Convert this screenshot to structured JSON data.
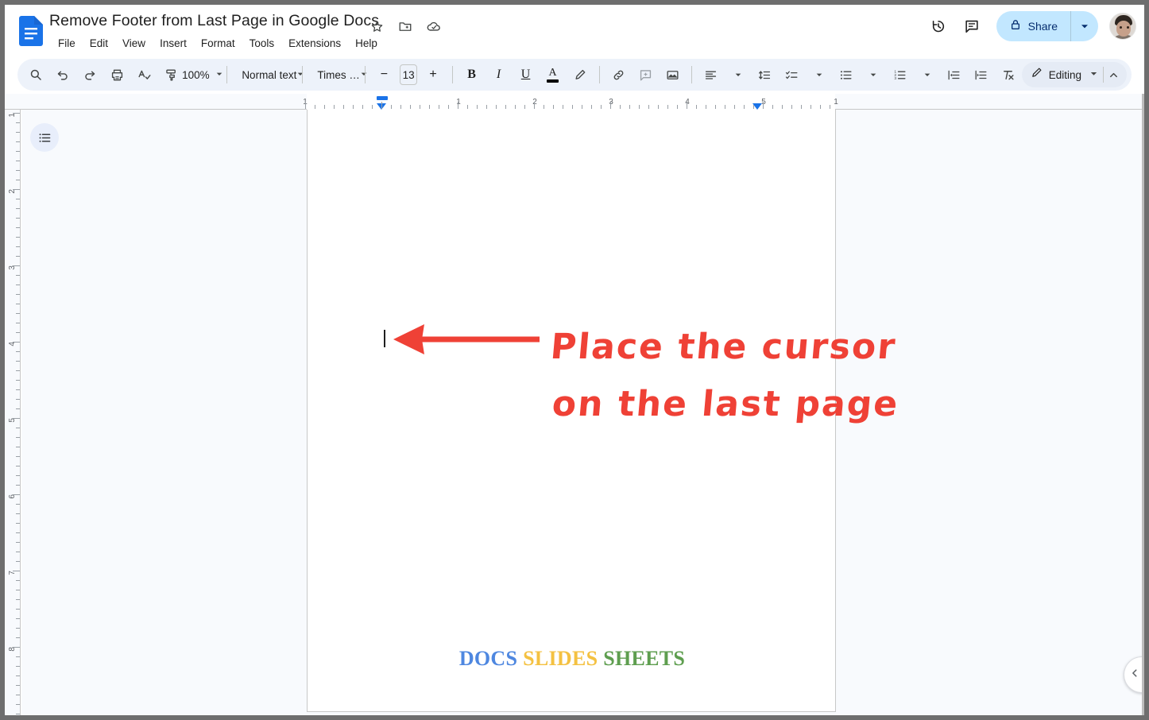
{
  "app": {
    "name": "Google Docs",
    "doc_icon": "google-docs-file-icon"
  },
  "header": {
    "title": "Remove Footer from Last Page in Google Docs",
    "menu": [
      "File",
      "Edit",
      "View",
      "Insert",
      "Format",
      "Tools",
      "Extensions",
      "Help"
    ],
    "title_icons": [
      "star-icon",
      "move-to-folder-icon",
      "cloud-saved-icon"
    ],
    "right": {
      "version_history_label": "version-history-icon",
      "comments_label": "comments-icon",
      "share_label": "Share",
      "share_lock_icon": "lock-icon",
      "share_caret_icon": "chevron-down-icon",
      "avatar_label": "account-avatar",
      "share_bg": "#c2e7ff",
      "share_text_color": "#062e6f"
    }
  },
  "toolbar": {
    "search_icon": "search-icon",
    "undo_icon": "undo-icon",
    "redo_icon": "redo-icon",
    "print_icon": "print-icon",
    "spellcheck_icon": "spelling-grammar-check-icon",
    "paint_format_icon": "paint-format-icon",
    "zoom_value": "100%",
    "style_value": "Normal text",
    "font_value": "Times …",
    "font_size_decrease": "−",
    "font_size_value": "13",
    "font_size_increase": "+",
    "bold_label": "B",
    "italic_label": "I",
    "underline_label": "U",
    "text_color_label": "A",
    "highlight_icon": "highlight-pen-icon",
    "link_icon": "insert-link-icon",
    "comment_icon": "add-comment-icon",
    "image_icon": "insert-image-icon",
    "align_icon": "align-left-icon",
    "line_spacing_icon": "line-spacing-icon",
    "checklist_icon": "checklist-icon",
    "bulleted_list_icon": "bulleted-list-icon",
    "numbered_list_icon": "numbered-list-icon",
    "decrease_indent_icon": "decrease-indent-icon",
    "increase_indent_icon": "increase-indent-icon",
    "clear_formatting_icon": "clear-formatting-icon",
    "mode_icon": "pencil-icon",
    "mode_label": "Editing",
    "mode_caret_icon": "chevron-down-icon",
    "collapse_icon": "chevron-up-icon",
    "bg": "#edf2fa"
  },
  "ruler": {
    "horizontal_labels": [
      "1",
      "1",
      "2",
      "3",
      "4",
      "5",
      "1"
    ],
    "vertical_labels": [
      "1",
      "2",
      "3",
      "4",
      "5",
      "6",
      "7",
      "8"
    ],
    "marker_color": "#1a73e8",
    "left_indent_position": "1 inch",
    "right_indent_position": "5 inches"
  },
  "document": {
    "outline_button_icon": "document-outline-icon",
    "cursor": "text-cursor",
    "footer": {
      "parts": [
        {
          "text": "DOCS",
          "color": "#4e87e0"
        },
        {
          "text": "SLIDES",
          "color": "#f4c141"
        },
        {
          "text": "SHEETS",
          "color": "#5e9e4f"
        }
      ]
    }
  },
  "annotation": {
    "color": "#ef4136",
    "arrow_icon": "left-arrow-annotation",
    "line1": "Place the cursor",
    "line2": "on the last page"
  },
  "right_panel": {
    "toggle_icon": "chevron-left-icon"
  }
}
